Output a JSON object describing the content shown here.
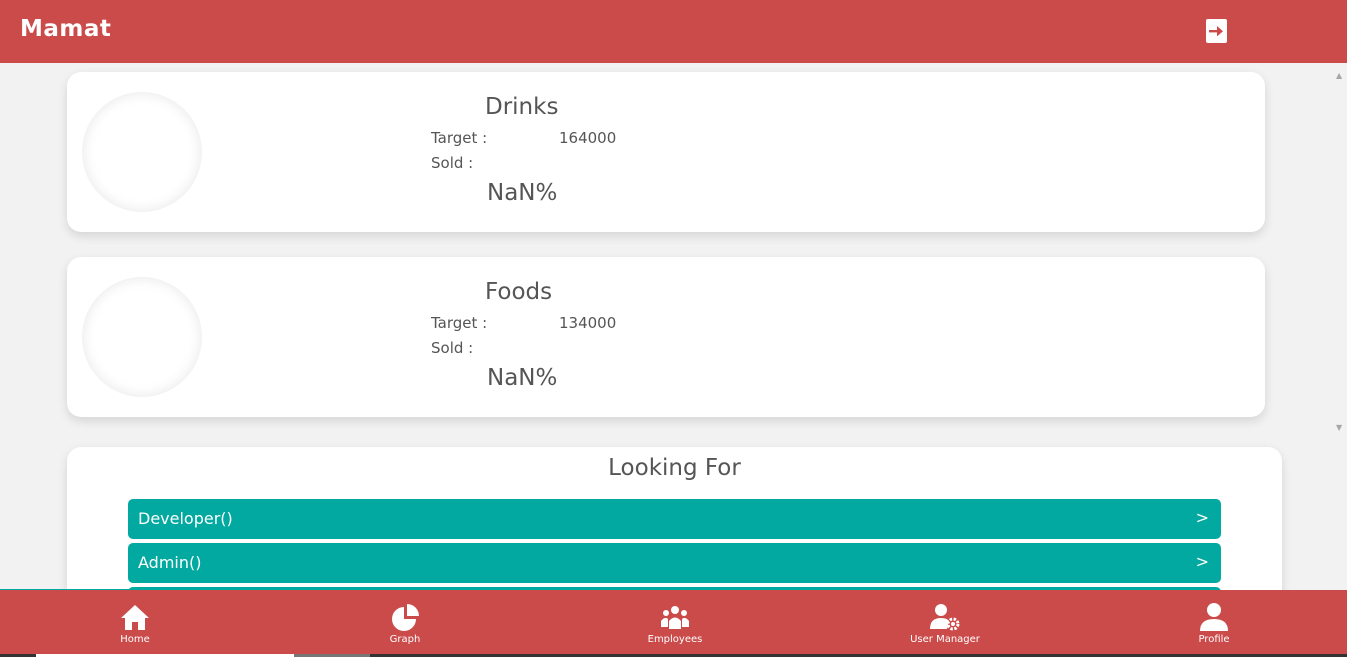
{
  "header": {
    "brand": "Mamat",
    "logout_icon": "logout-icon"
  },
  "cards": [
    {
      "title": "Drinks",
      "target_label": "Target :",
      "target_value": "164000",
      "sold_label": "Sold :",
      "percent": "NaN%"
    },
    {
      "title": "Foods",
      "target_label": "Target :",
      "target_value": "134000",
      "sold_label": "Sold :",
      "percent": "NaN%"
    }
  ],
  "looking_for": {
    "title": "Looking For",
    "items": [
      {
        "label": "Developer()",
        "arrow": ">"
      },
      {
        "label": "Admin()",
        "arrow": ">"
      }
    ]
  },
  "bottom_nav": {
    "items": [
      {
        "label": "Home",
        "icon": "home-icon"
      },
      {
        "label": "Graph",
        "icon": "pie-chart-icon"
      },
      {
        "label": "Employees",
        "icon": "people-icon"
      },
      {
        "label": "User Manager",
        "icon": "user-gear-icon"
      },
      {
        "label": "Profile",
        "icon": "user-icon"
      }
    ],
    "active": "Home"
  },
  "colors": {
    "primary": "#cb4b4b",
    "accent": "#01a9a0",
    "background": "#f2f2f2"
  }
}
